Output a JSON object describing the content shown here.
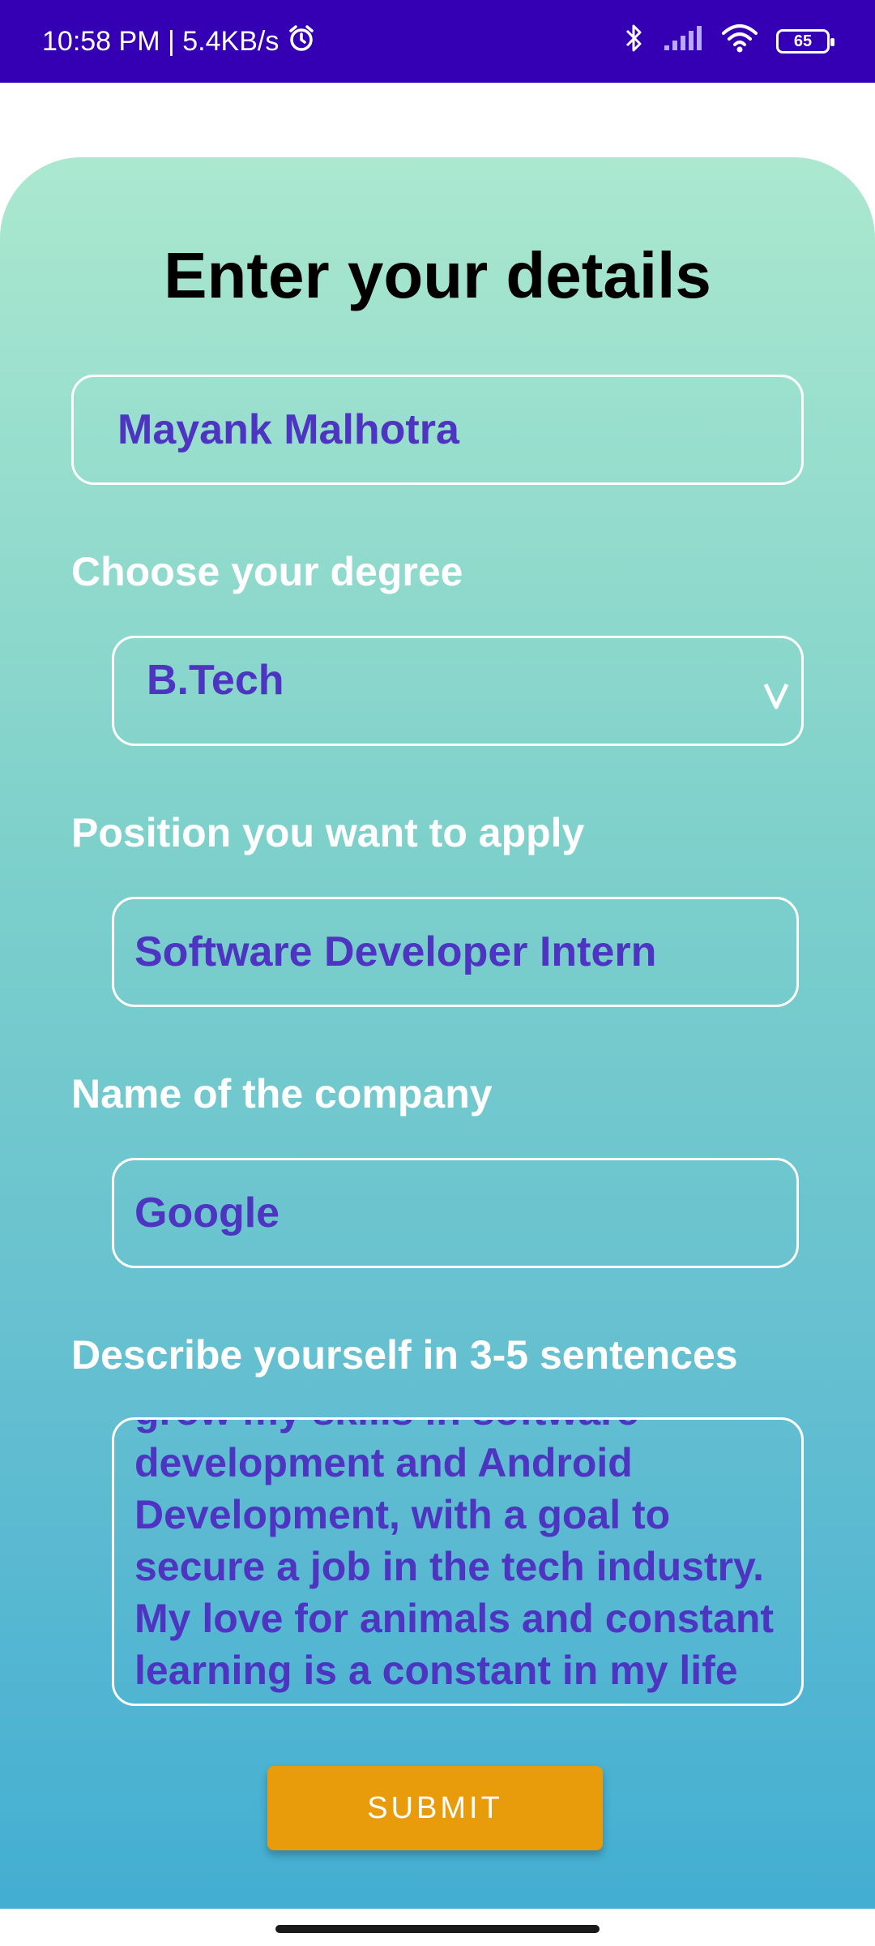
{
  "status_bar": {
    "time_speed": "10:58 PM | 5.4KB/s",
    "battery_level": "65",
    "icons": [
      "alarm-icon",
      "bluetooth-icon",
      "signal-icon",
      "wifi-icon",
      "battery-icon"
    ]
  },
  "form": {
    "title": "Enter your details",
    "name_value": "Mayank Malhotra",
    "degree_label": "Choose your degree",
    "degree_value": "B.Tech",
    "position_label": "Position you want to apply",
    "position_value": "Software Developer Intern",
    "company_label": "Name of the company",
    "company_value": "Google",
    "describe_label": "Describe yourself in 3-5 sentences",
    "describe_value": "grow my skills in software\ndevelopment and Android\nDevelopment, with a goal to\nsecure a job in the tech industry.\nMy love for animals and constant\nlearning is a constant in my life",
    "submit_label": "SUBMIT"
  },
  "colors": {
    "status_bar": "#3500b4",
    "input_text": "#4d35c2",
    "submit_button": "#e89b0b",
    "gradient_top": "#abe8cf",
    "gradient_bottom": "#43aed2"
  }
}
